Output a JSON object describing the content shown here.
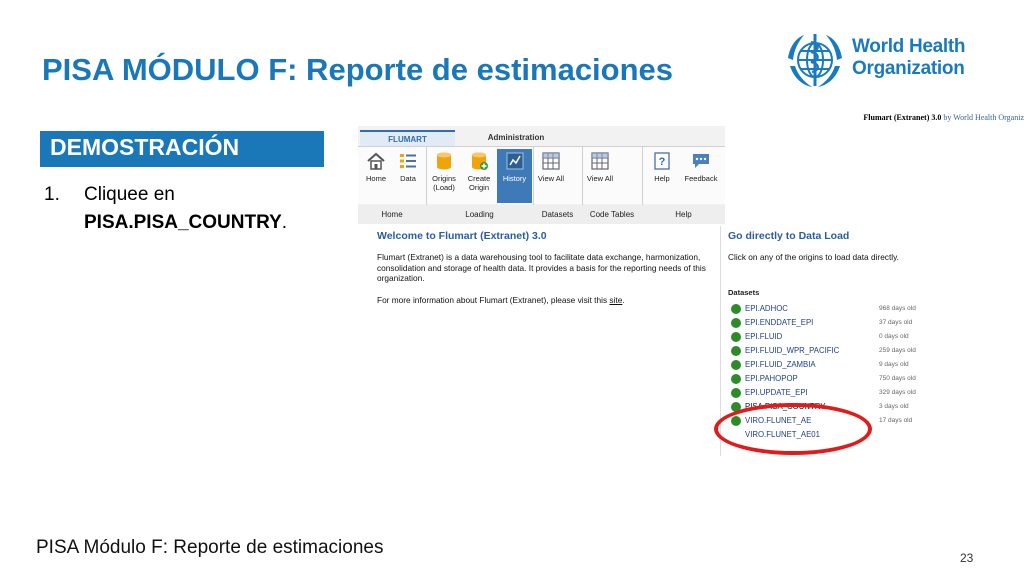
{
  "slide": {
    "title": "PISA MÓDULO F: Reporte de estimaciones",
    "demo_label": "DEMOSTRACIÓN",
    "instruction": {
      "number": "1.",
      "line1": "Cliquee en",
      "line2": "PISA.PISA_COUNTRY",
      "period": "."
    },
    "footer": "PISA Módulo F: Reporte de estimaciones",
    "page_number": "23"
  },
  "logo": {
    "line1": "World Health",
    "line2": "Organization",
    "icon": "who-emblem-icon",
    "color": "#1a7ac0"
  },
  "app": {
    "brand": "Flumart (Extranet) 3.0",
    "brand_by": "by World Health Organiz",
    "tabs": [
      "FLUMART",
      "Administration"
    ],
    "ribbon_buttons": [
      {
        "label": "Home",
        "icon": "home-icon"
      },
      {
        "label": "Data",
        "icon": "list-icon"
      },
      {
        "label": "Origins (Load)",
        "icon": "database-icon"
      },
      {
        "label": "Create Origin",
        "icon": "database-add-icon"
      },
      {
        "label": "History",
        "icon": "history-icon"
      },
      {
        "label": "View All",
        "icon": "grid-icon"
      },
      {
        "label": "View All",
        "icon": "grid-icon"
      },
      {
        "label": "Help",
        "icon": "help-icon"
      },
      {
        "label": "Feedback",
        "icon": "feedback-icon"
      }
    ],
    "ribbon_groups": [
      "Home",
      "Loading",
      "Datasets",
      "Code Tables",
      "Help"
    ],
    "welcome_title": "Welcome to Flumart (Extranet) 3.0",
    "welcome_text": "Flumart (Extranet) is a data warehousing tool to facilitate data exchange, harmonization, consolidation and storage of health data. It provides a basis for the reporting needs of this organization.",
    "welcome_more": "For more information about Flumart (Extranet), please visit this",
    "welcome_link": "site",
    "direct_title": "Go directly to Data Load",
    "direct_text": "Click on any of the origins to load data directly.",
    "datasets_heading": "Datasets",
    "datasets": [
      {
        "name": "EPI.ADHOC",
        "age": "968 days old"
      },
      {
        "name": "EPI.ENDDATE_EPI",
        "age": "37 days old"
      },
      {
        "name": "EPI.FLUID",
        "age": "0 days old"
      },
      {
        "name": "EPI.FLUID_WPR_PACIFIC",
        "age": "259 days old"
      },
      {
        "name": "EPI.FLUID_ZAMBIA",
        "age": "9 days old"
      },
      {
        "name": "EPI.PAHOPOP",
        "age": "750 days old"
      },
      {
        "name": "EPI.UPDATE_EPI",
        "age": "329 days old"
      },
      {
        "name": "PISA.PISA_COUNTRY",
        "age": "3 days old"
      },
      {
        "name": "VIRO.FLUNET_AE",
        "age": "17 days old"
      },
      {
        "name": "VIRO.FLUNET_AE01",
        "age": ""
      }
    ],
    "accent": "#2f6db5",
    "highlight_color": "#e11b1b"
  }
}
